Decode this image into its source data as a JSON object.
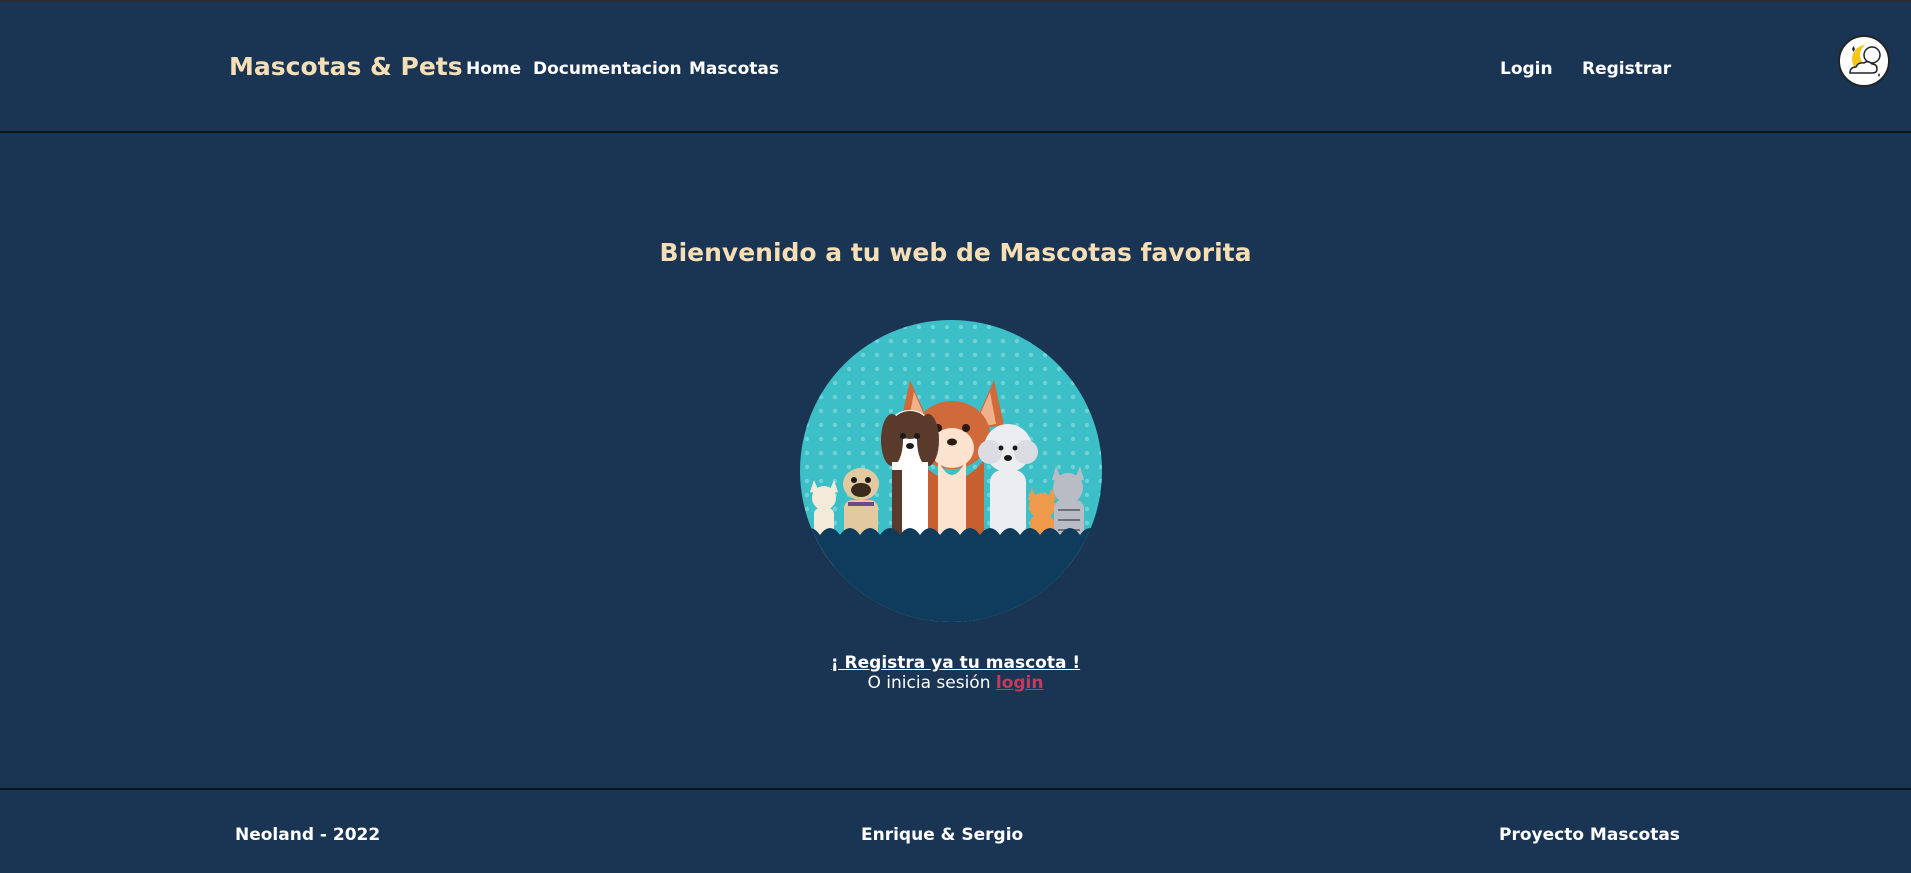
{
  "header": {
    "brand": "Mascotas & Pets",
    "nav": [
      {
        "label": "Home"
      },
      {
        "label": "Documentacion"
      },
      {
        "label": "Mascotas"
      }
    ],
    "auth": {
      "login": "Login",
      "register": "Registrar"
    },
    "theme_toggle_icon": "moon-cloud-icon"
  },
  "main": {
    "title": "Bienvenido a tu web de Mascotas favorita",
    "image_icon": "pets-group-illustration",
    "cta_register": "¡ Registra ya tu mascota !",
    "cta_prefix": "O inicia sesión",
    "cta_login": "login"
  },
  "footer": {
    "left": "Neoland - 2022",
    "center": "Enrique & Sergio",
    "right": "Proyecto Mascotas"
  },
  "colors": {
    "background": "#1a3553",
    "brand": "#f6dfb6",
    "link_accent": "#c23a5e",
    "illustration_bg": "#3cbfc6",
    "illustration_ground": "#0f3b5c"
  }
}
